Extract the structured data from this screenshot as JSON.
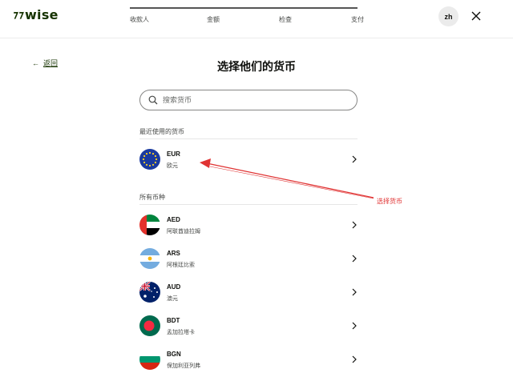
{
  "header": {
    "logo": "wise",
    "steps": [
      {
        "label": "收款人"
      },
      {
        "label": "金额"
      },
      {
        "label": "检查"
      },
      {
        "label": "支付"
      }
    ],
    "progress_fraction": 1.0,
    "language_badge": "zh"
  },
  "nav": {
    "back_label": "返回"
  },
  "page": {
    "title": "选择他们的货币"
  },
  "search": {
    "placeholder": "搜索货币",
    "value": ""
  },
  "sections": {
    "recent_label": "最近使用的货币",
    "all_label": "所有币种"
  },
  "recent_currencies": [
    {
      "code": "EUR",
      "name": "欧元",
      "flag": "eu-flag"
    }
  ],
  "all_currencies": [
    {
      "code": "AED",
      "name": "阿联酋迪拉姆",
      "flag": "uae-flag"
    },
    {
      "code": "ARS",
      "name": "阿根廷比索",
      "flag": "argentina-flag"
    },
    {
      "code": "AUD",
      "name": "澳元",
      "flag": "australia-flag"
    },
    {
      "code": "BDT",
      "name": "孟加拉塔卡",
      "flag": "bangladesh-flag"
    },
    {
      "code": "BGN",
      "name": "保加利亚列弗",
      "flag": "bulgaria-flag"
    }
  ],
  "annotation": {
    "text": "选择货币",
    "color": "#e03333"
  },
  "colors": {
    "brand": "#163300",
    "text": "#0e0f0c",
    "muted": "#454745"
  }
}
